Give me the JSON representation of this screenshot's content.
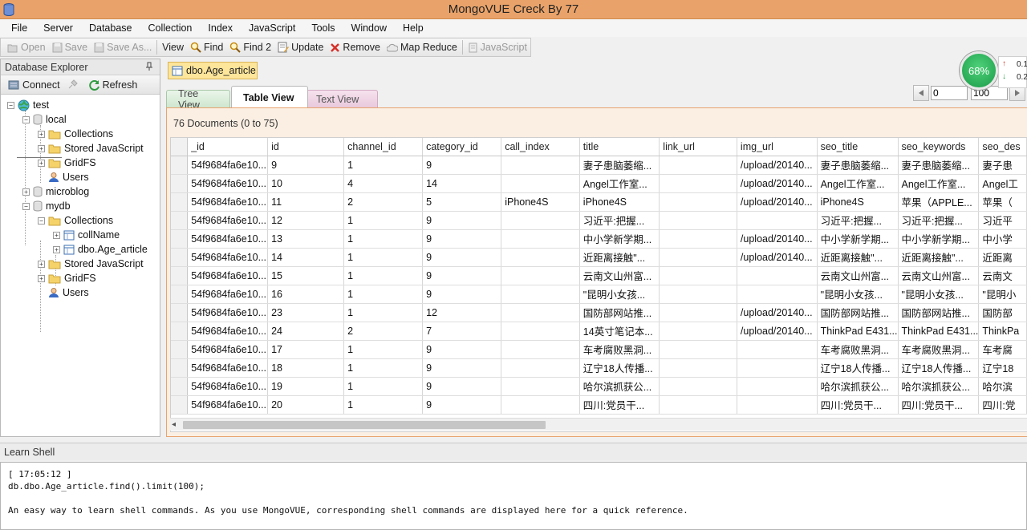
{
  "window": {
    "title": "MongoVUE Creck By 77"
  },
  "menu": [
    "File",
    "Server",
    "Database",
    "Collection",
    "Index",
    "JavaScript",
    "Tools",
    "Window",
    "Help"
  ],
  "toolbar": {
    "open": "Open",
    "save": "Save",
    "save_as": "Save As...",
    "view": "View",
    "find": "Find",
    "find2": "Find 2",
    "update": "Update",
    "remove": "Remove",
    "map_reduce": "Map Reduce",
    "javascript": "JavaScript"
  },
  "explorer": {
    "title": "Database Explorer",
    "connect": "Connect",
    "refresh": "Refresh",
    "tree": {
      "server": "test",
      "local": "local",
      "local_collections": "Collections",
      "local_stored_js": "Stored JavaScript",
      "local_gridfs": "GridFS",
      "local_users": "Users",
      "microblog": "microblog",
      "mydb": "mydb",
      "mydb_collections": "Collections",
      "coll_name": "collName",
      "coll_age_article": "dbo.Age_article",
      "mydb_stored_js": "Stored JavaScript",
      "mydb_gridfs": "GridFS",
      "mydb_users": "Users"
    }
  },
  "document_tab": "dbo.Age_article",
  "view_tabs": {
    "tree": "Tree View",
    "table": "Table View",
    "text": "Text View"
  },
  "pager": {
    "skip": "0",
    "limit": "100"
  },
  "gauge": {
    "percent": "68%",
    "up": "0.1",
    "down": "0.2"
  },
  "doc_count": "76 Documents (0 to 75)",
  "columns": [
    "_id",
    "id",
    "channel_id",
    "category_id",
    "call_index",
    "title",
    "link_url",
    "img_url",
    "seo_title",
    "seo_keywords",
    "seo_des"
  ],
  "rows": [
    [
      "54f9684fa6e10...",
      "9",
      "1",
      "9",
      "",
      "妻子患脑萎缩...",
      "",
      "/upload/20140...",
      "妻子患脑萎缩...",
      "妻子患脑萎缩...",
      "妻子患"
    ],
    [
      "54f9684fa6e10...",
      "10",
      "4",
      "14",
      "",
      "Angel工作室...",
      "",
      "/upload/20140...",
      "Angel工作室...",
      "Angel工作室...",
      "Angel工"
    ],
    [
      "54f9684fa6e10...",
      "11",
      "2",
      "5",
      "iPhone4S",
      "iPhone4S",
      "",
      "/upload/20140...",
      "iPhone4S",
      "苹果（APPLE...",
      "苹果（"
    ],
    [
      "54f9684fa6e10...",
      "12",
      "1",
      "9",
      "",
      "习近平:把握...",
      "",
      "",
      "习近平:把握...",
      "习近平:把握...",
      "习近平"
    ],
    [
      "54f9684fa6e10...",
      "13",
      "1",
      "9",
      "",
      "中小学新学期...",
      "",
      "/upload/20140...",
      "中小学新学期...",
      "中小学新学期...",
      "中小学"
    ],
    [
      "54f9684fa6e10...",
      "14",
      "1",
      "9",
      "",
      "近距离接触\"...",
      "",
      "/upload/20140...",
      "近距离接触\"...",
      "近距离接触\"...",
      "近距离"
    ],
    [
      "54f9684fa6e10...",
      "15",
      "1",
      "9",
      "",
      "云南文山州富...",
      "",
      "",
      "云南文山州富...",
      "云南文山州富...",
      "云南文"
    ],
    [
      "54f9684fa6e10...",
      "16",
      "1",
      "9",
      "",
      "\"昆明小女孩...",
      "",
      "",
      "\"昆明小女孩...",
      "\"昆明小女孩...",
      "\"昆明小"
    ],
    [
      "54f9684fa6e10...",
      "23",
      "1",
      "12",
      "",
      "国防部网站推...",
      "",
      "/upload/20140...",
      "国防部网站推...",
      "国防部网站推...",
      "国防部"
    ],
    [
      "54f9684fa6e10...",
      "24",
      "2",
      "7",
      "",
      "14英寸笔记本...",
      "",
      "/upload/20140...",
      "ThinkPad E431...",
      "ThinkPad E431...",
      "ThinkPa"
    ],
    [
      "54f9684fa6e10...",
      "17",
      "1",
      "9",
      "",
      "车考腐败黑洞...",
      "",
      "",
      "车考腐败黑洞...",
      "车考腐败黑洞...",
      "车考腐"
    ],
    [
      "54f9684fa6e10...",
      "18",
      "1",
      "9",
      "",
      "辽宁18人传播...",
      "",
      "",
      "辽宁18人传播...",
      "辽宁18人传播...",
      "辽宁18"
    ],
    [
      "54f9684fa6e10...",
      "19",
      "1",
      "9",
      "",
      "哈尔滨抓获公...",
      "",
      "",
      "哈尔滨抓获公...",
      "哈尔滨抓获公...",
      "哈尔滨"
    ],
    [
      "54f9684fa6e10...",
      "20",
      "1",
      "9",
      "",
      "四川:党员干...",
      "",
      "",
      "四川:党员干...",
      "四川:党员干...",
      "四川:党"
    ]
  ],
  "shell": {
    "title": "Learn Shell",
    "timestamp": "[ 17:05:12 ]",
    "command": "db.dbo.Age_article.find().limit(100);",
    "hint": "An easy way to learn shell commands. As you use MongoVUE, corresponding shell commands are displayed here for a quick reference."
  }
}
